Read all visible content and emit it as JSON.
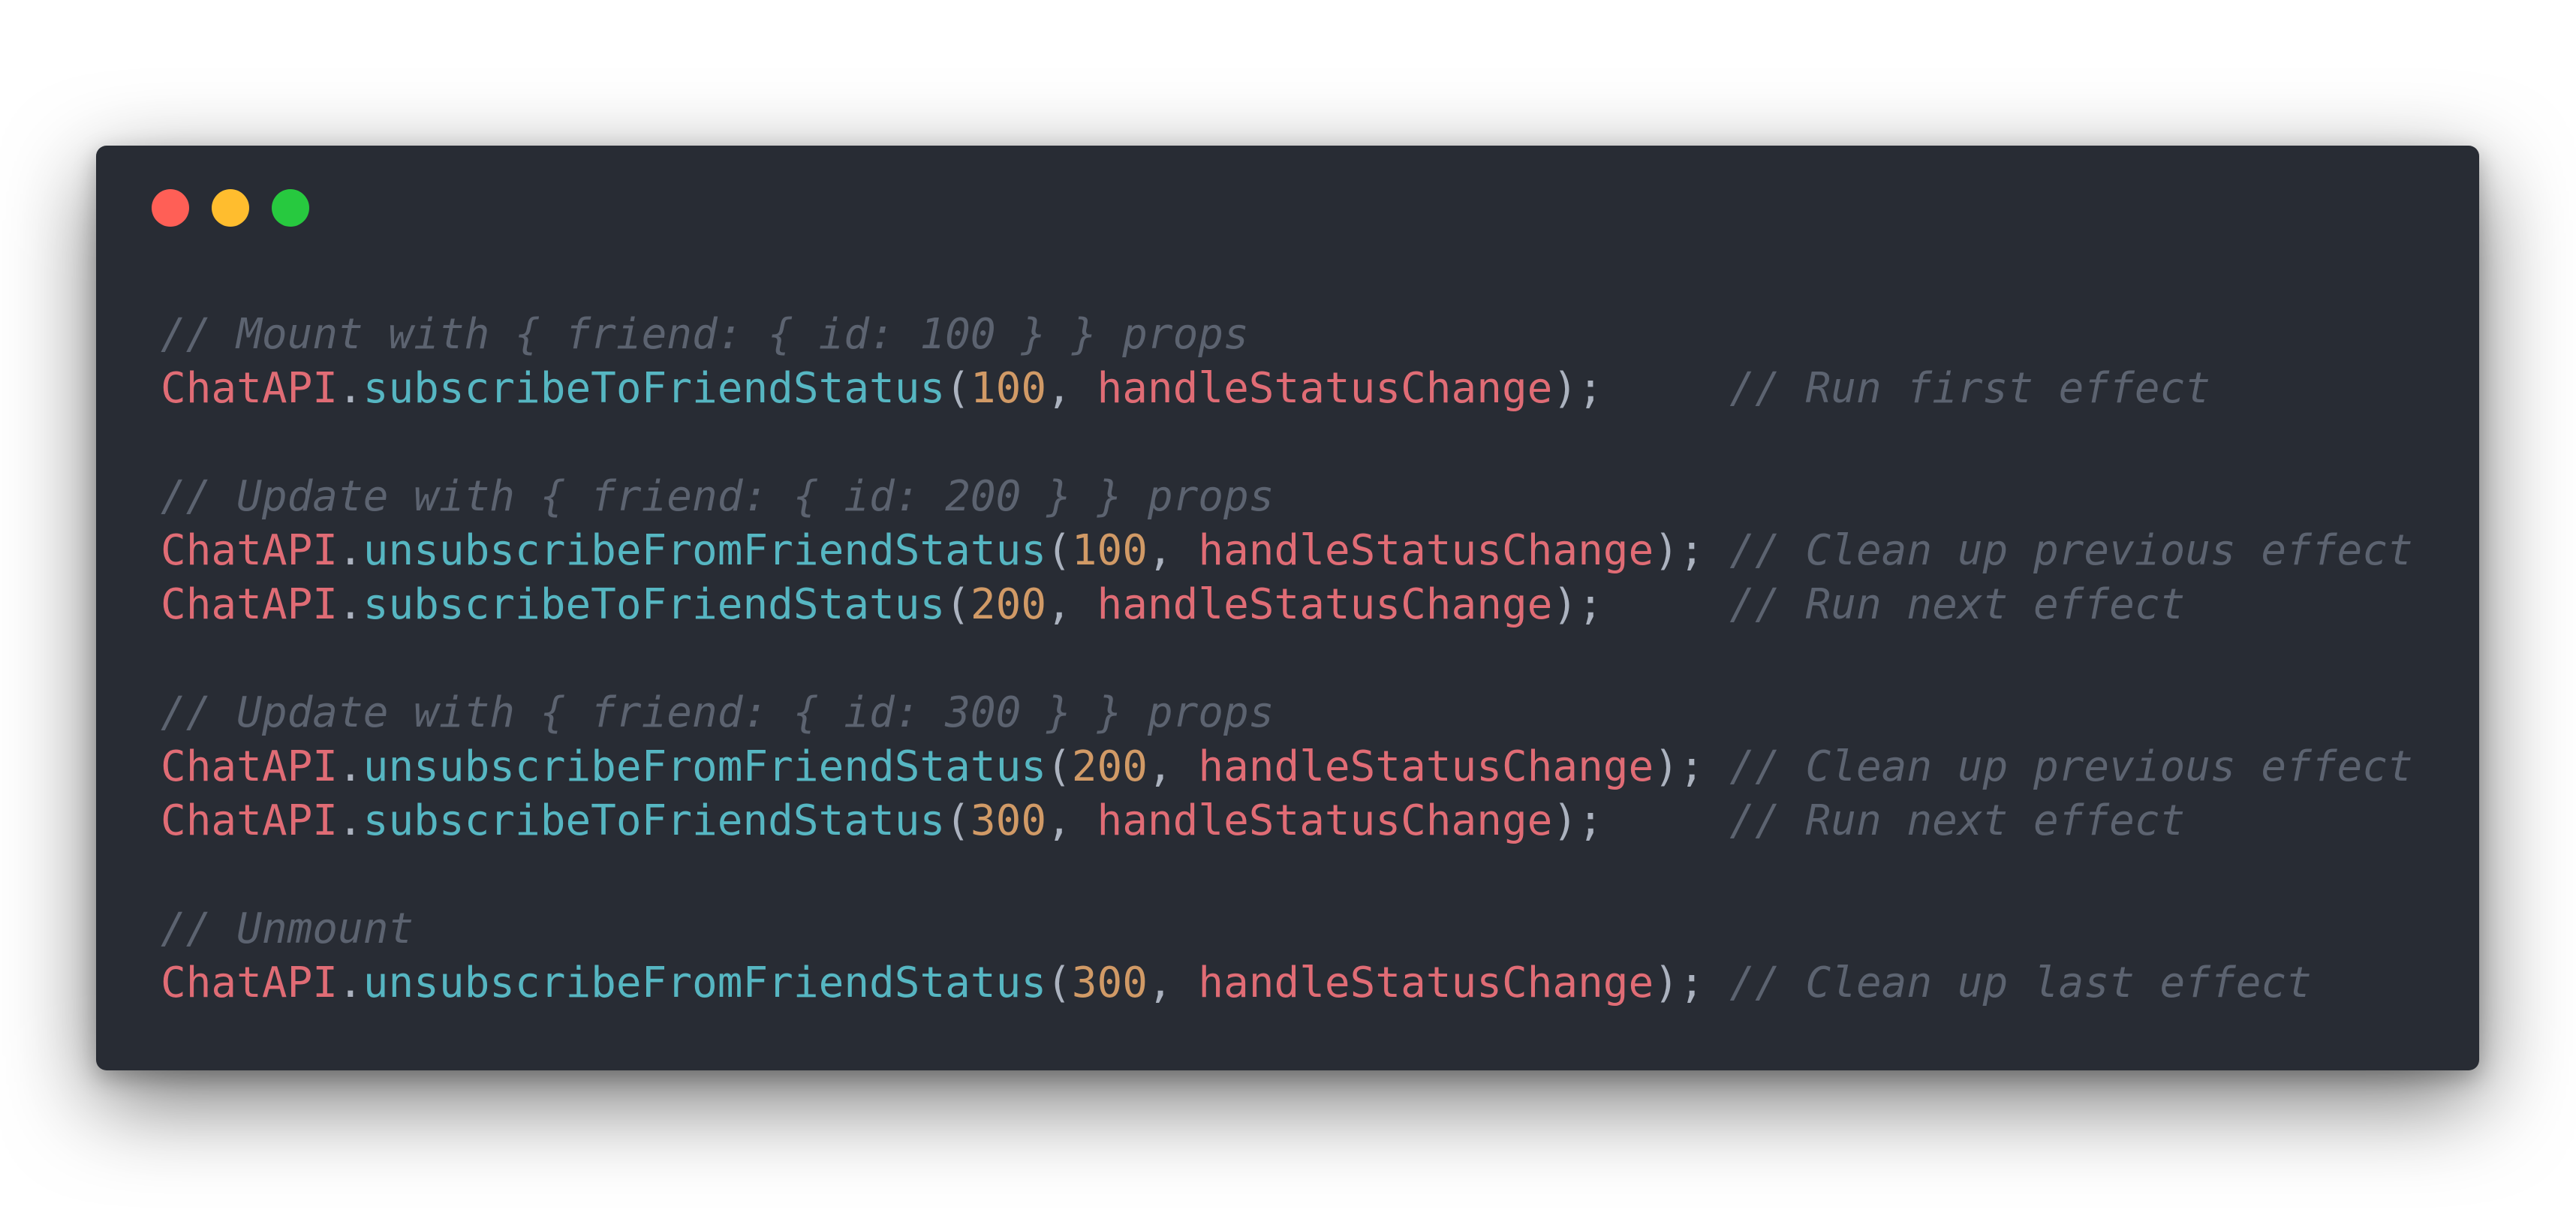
{
  "window": {
    "controls": {
      "close_color": "#ff5f56",
      "minimize_color": "#ffbd2e",
      "maximize_color": "#27c93f"
    },
    "background": "#282c34"
  },
  "code": {
    "blocks": [
      {
        "comment": "// Mount with { friend: { id: 100 } } props",
        "lines": [
          {
            "obj": "ChatAPI",
            "dot": ".",
            "fn": "subscribeToFriendStatus",
            "open": "(",
            "num": "100",
            "sep": ", ",
            "param": "handleStatusChange",
            "close": ");",
            "pad": "     ",
            "comment": "// Run first effect"
          }
        ]
      },
      {
        "comment": "// Update with { friend: { id: 200 } } props",
        "lines": [
          {
            "obj": "ChatAPI",
            "dot": ".",
            "fn": "unsubscribeFromFriendStatus",
            "open": "(",
            "num": "100",
            "sep": ", ",
            "param": "handleStatusChange",
            "close": ");",
            "pad": " ",
            "comment": "// Clean up previous effect"
          },
          {
            "obj": "ChatAPI",
            "dot": ".",
            "fn": "subscribeToFriendStatus",
            "open": "(",
            "num": "200",
            "sep": ", ",
            "param": "handleStatusChange",
            "close": ");",
            "pad": "     ",
            "comment": "// Run next effect"
          }
        ]
      },
      {
        "comment": "// Update with { friend: { id: 300 } } props",
        "lines": [
          {
            "obj": "ChatAPI",
            "dot": ".",
            "fn": "unsubscribeFromFriendStatus",
            "open": "(",
            "num": "200",
            "sep": ", ",
            "param": "handleStatusChange",
            "close": ");",
            "pad": " ",
            "comment": "// Clean up previous effect"
          },
          {
            "obj": "ChatAPI",
            "dot": ".",
            "fn": "subscribeToFriendStatus",
            "open": "(",
            "num": "300",
            "sep": ", ",
            "param": "handleStatusChange",
            "close": ");",
            "pad": "     ",
            "comment": "// Run next effect"
          }
        ]
      },
      {
        "comment": "// Unmount",
        "lines": [
          {
            "obj": "ChatAPI",
            "dot": ".",
            "fn": "unsubscribeFromFriendStatus",
            "open": "(",
            "num": "300",
            "sep": ", ",
            "param": "handleStatusChange",
            "close": ");",
            "pad": " ",
            "comment": "// Clean up last effect"
          }
        ]
      }
    ],
    "syntax_colors": {
      "comment": "#5c6370",
      "object": "#e06c75",
      "function": "#56b6c2",
      "number": "#d19a66",
      "punctuation": "#abb2bf"
    }
  }
}
